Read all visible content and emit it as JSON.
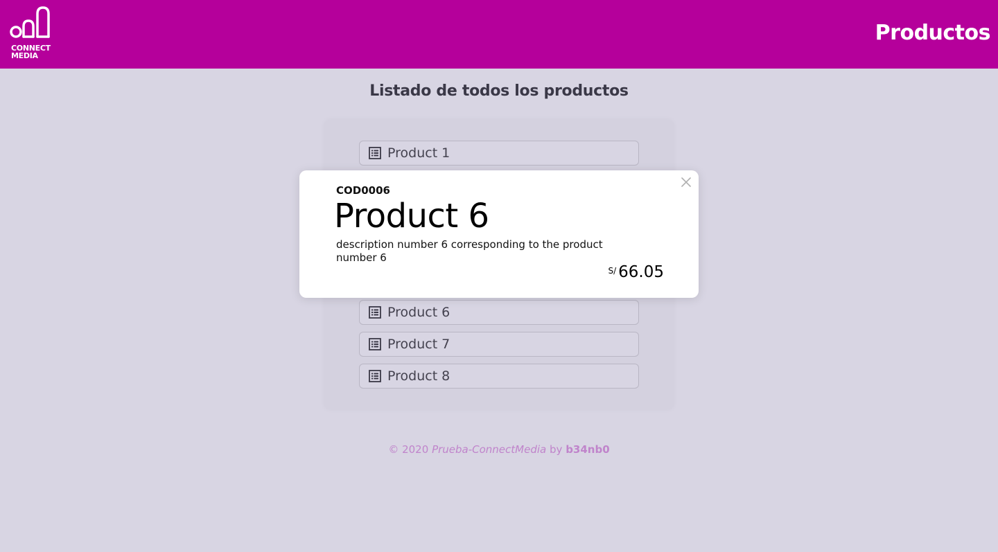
{
  "header": {
    "logo_line1": "CONNECT",
    "logo_line2": "MEDIA",
    "title": "Productos",
    "brand_color": "#b5009b"
  },
  "main": {
    "heading": "Listado de todos los productos",
    "visible_products": [
      {
        "label": "Product 1",
        "icon": "list-icon"
      },
      {
        "label": "Product 6",
        "icon": "list-icon"
      },
      {
        "label": "Product 7",
        "icon": "list-icon"
      },
      {
        "label": "Product 8",
        "icon": "list-icon"
      }
    ]
  },
  "modal": {
    "code": "COD0006",
    "name": "Product 6",
    "description": "description number 6 corresponding to the product number 6",
    "currency": "S/",
    "price": "66.05",
    "close_icon": "close-icon"
  },
  "footer": {
    "copyright": "© 2020",
    "project": "Prueba-ConnectMedia",
    "by": "by",
    "author": "b34nb0"
  }
}
